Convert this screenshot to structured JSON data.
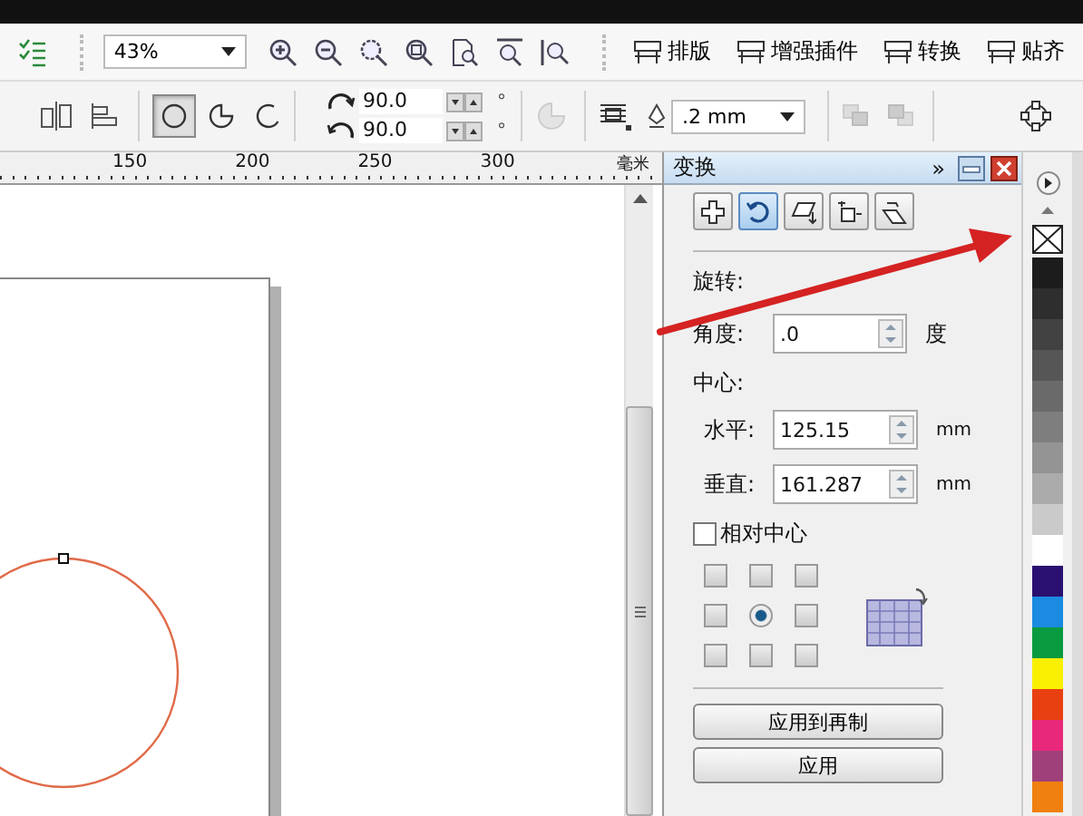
{
  "toolbar": {
    "zoom": "43%",
    "menus": [
      {
        "label": "排版"
      },
      {
        "label": "增强插件"
      },
      {
        "label": "转换"
      },
      {
        "label": "贴齐"
      }
    ]
  },
  "property_bar": {
    "arc_modes": [
      {
        "kind": "ellipse",
        "selected": true
      },
      {
        "kind": "pie",
        "selected": false
      },
      {
        "kind": "arc",
        "selected": false
      }
    ],
    "angles": [
      {
        "kind": "start",
        "value": "90.0",
        "unit": "°"
      },
      {
        "kind": "end",
        "value": "90.0",
        "unit": "°"
      }
    ],
    "outline_width": ".2 mm"
  },
  "ruler": {
    "labels": [
      "150",
      "200",
      "250",
      "300"
    ],
    "unit": "毫米"
  },
  "docker": {
    "title": "变换",
    "expand_glyph": "»",
    "tabs": [
      {
        "kind": "position",
        "selected": false
      },
      {
        "kind": "rotate",
        "selected": true
      },
      {
        "kind": "scale",
        "selected": false
      },
      {
        "kind": "size",
        "selected": false
      },
      {
        "kind": "skew",
        "selected": false
      }
    ],
    "section": "旋转:",
    "angle": {
      "label": "角度:",
      "value": ".0",
      "unit": "度"
    },
    "center_label": "中心:",
    "center_fields": [
      {
        "label": "水平:",
        "value": "125.15",
        "unit": "mm"
      },
      {
        "label": "垂直:",
        "value": "161.287",
        "unit": "mm"
      }
    ],
    "relative_center": {
      "label": "相对中心",
      "checked": false
    },
    "anchors": [
      {
        "selected": false
      },
      {
        "selected": false
      },
      {
        "selected": false
      },
      {
        "selected": false
      },
      {
        "selected": true
      },
      {
        "selected": false
      },
      {
        "selected": false
      },
      {
        "selected": false
      },
      {
        "selected": false
      }
    ],
    "buttons": [
      "应用到再制",
      "应用"
    ]
  },
  "palette": [
    {
      "kind": "none"
    },
    {
      "kind": "color",
      "color": "#1c1c1c"
    },
    {
      "kind": "color",
      "color": "#2e2e2e"
    },
    {
      "kind": "color",
      "color": "#424242"
    },
    {
      "kind": "color",
      "color": "#565656"
    },
    {
      "kind": "color",
      "color": "#6a6a6a"
    },
    {
      "kind": "color",
      "color": "#7e7e7e"
    },
    {
      "kind": "color",
      "color": "#949494"
    },
    {
      "kind": "color",
      "color": "#ababab"
    },
    {
      "kind": "color",
      "color": "#cacaca"
    },
    {
      "kind": "color",
      "color": "#ffffff"
    },
    {
      "kind": "color",
      "color": "#2a1070"
    },
    {
      "kind": "color",
      "color": "#1a8be0"
    },
    {
      "kind": "color",
      "color": "#0a9a40"
    },
    {
      "kind": "color",
      "color": "#f8f000"
    },
    {
      "kind": "color",
      "color": "#e84010"
    },
    {
      "kind": "color",
      "color": "#e8287a"
    },
    {
      "kind": "color",
      "color": "#a0407a"
    },
    {
      "kind": "color",
      "color": "#f08010"
    }
  ]
}
